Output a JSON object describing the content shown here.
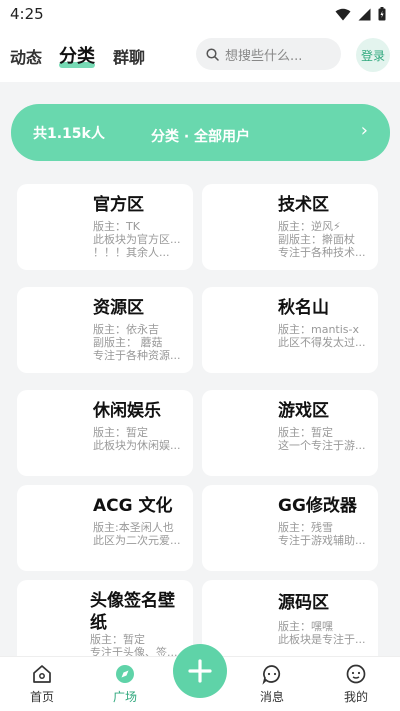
{
  "status_bar": {
    "time": "4:25"
  },
  "header": {
    "tabs": [
      {
        "label": "动态"
      },
      {
        "label": "分类"
      },
      {
        "label": "群聊"
      }
    ],
    "search_placeholder": "想搜些什么...",
    "login_label": "登录"
  },
  "banner": {
    "count": "共1.15k人",
    "title": "分类 · 全部用户",
    "chevron": "›"
  },
  "sections": [
    {
      "name": "官方区",
      "lines": [
        "版主：TK",
        "此板块为官方区...",
        "！！！其余人..."
      ]
    },
    {
      "name": "技术区",
      "lines": [
        "版主：逆风⚡",
        "副版主：擀面杖",
        "专注于各种技术..."
      ]
    },
    {
      "name": "资源区",
      "lines": [
        "版主：依永吉",
        "副版主：  蘑菇",
        "专注于各种资源..."
      ]
    },
    {
      "name": "秋名山",
      "lines": [
        "版主：mantis-x",
        "此区不得发太过..."
      ]
    },
    {
      "name": "休闲娱乐",
      "lines": [
        "版主：暂定",
        "此板块为休闲娱..."
      ]
    },
    {
      "name": "游戏区",
      "lines": [
        "版主：暂定",
        "这一个专注于游..."
      ]
    },
    {
      "name": "ACG 文化",
      "lines": [
        "版主:本圣闲人也",
        "此区为二次元爱..."
      ]
    },
    {
      "name": "GG修改器",
      "lines": [
        "版主：残雪",
        "专注于游戏辅助..."
      ]
    },
    {
      "name": "头像签名壁纸",
      "lines": [
        "版主：暂定",
        "专注于头像、签..."
      ]
    },
    {
      "name": "源码区",
      "lines": [
        "版主：嘿嘿",
        "此板块是专注于..."
      ]
    }
  ],
  "bottom_nav": {
    "items": [
      {
        "label": "首页",
        "icon": "home-icon"
      },
      {
        "label": "广场",
        "icon": "compass-icon"
      },
      {
        "label": "消息",
        "icon": "chat-icon"
      },
      {
        "label": "我的",
        "icon": "profile-icon"
      }
    ],
    "fab_icon": "plus-icon"
  },
  "colors": {
    "accent": "#5fd3a8",
    "banner": "#69d8ae",
    "background": "#f3f4f5"
  }
}
